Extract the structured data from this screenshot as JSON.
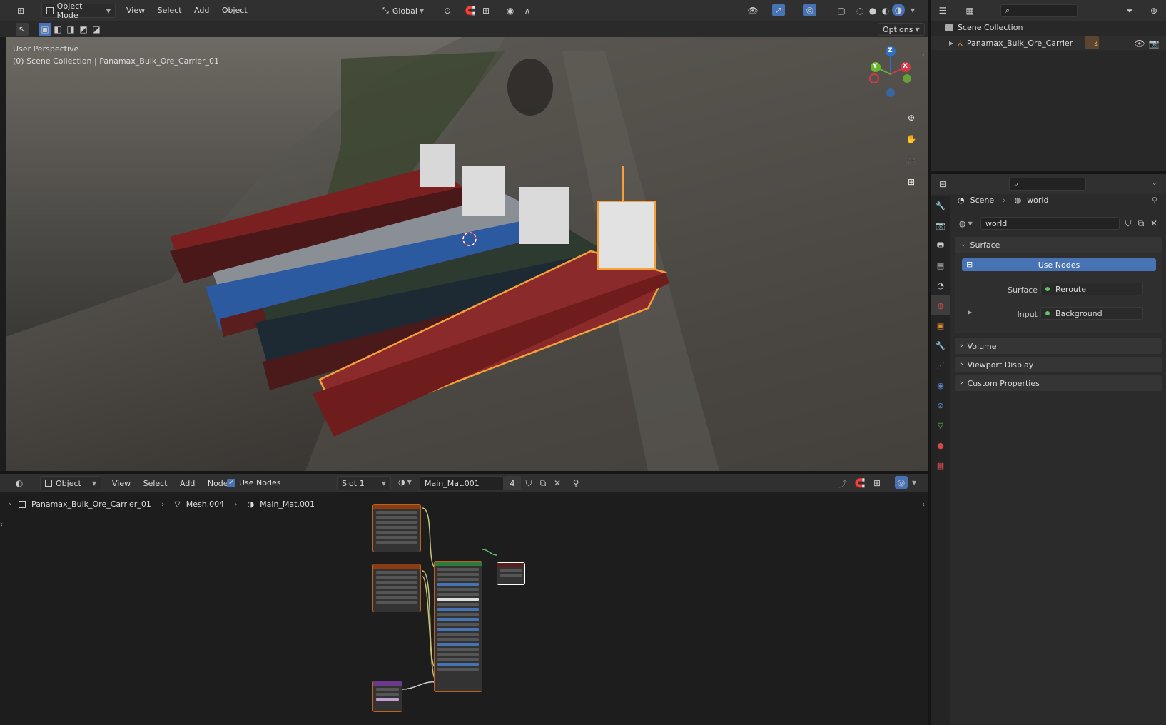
{
  "viewport_header": {
    "mode": "Object Mode",
    "menus": [
      "View",
      "Select",
      "Add",
      "Object"
    ],
    "transform_orientation": "Global",
    "options_label": "Options"
  },
  "viewport": {
    "perspective_label": "User Perspective",
    "collection_label": "(0) Scene Collection | Panamax_Bulk_Ore_Carrier_01",
    "gizmo_axes": [
      "Z",
      "Y",
      "X"
    ]
  },
  "outliner": {
    "root": "Scene Collection",
    "items": [
      {
        "label": "Panamax_Bulk_Ore_Carrier",
        "badge": "4"
      }
    ]
  },
  "properties": {
    "breadcrumb": [
      "Scene",
      "world"
    ],
    "world_name": "world",
    "panels": {
      "surface": {
        "title": "Surface",
        "use_nodes_label": "Use Nodes",
        "surface_label": "Surface",
        "surface_value": "Reroute",
        "input_label": "Input",
        "input_value": "Background"
      },
      "collapsed": [
        "Volume",
        "Viewport Display",
        "Custom Properties"
      ]
    }
  },
  "node_header": {
    "editor_type": "Object",
    "menus": [
      "View",
      "Select",
      "Add",
      "Node"
    ],
    "use_nodes_label": "Use Nodes",
    "use_nodes_checked": true,
    "slot": "Slot 1",
    "material": "Main_Mat.001",
    "users": "4"
  },
  "node_breadcrumb": [
    "Panamax_Bulk_Ore_Carrier_01",
    "Mesh.004",
    "Main_Mat.001"
  ],
  "colors": {
    "accent": "#4772b3",
    "selection_outline": "#f5a03c",
    "socket_green": "#63c763",
    "node_border": "#c0621e"
  }
}
